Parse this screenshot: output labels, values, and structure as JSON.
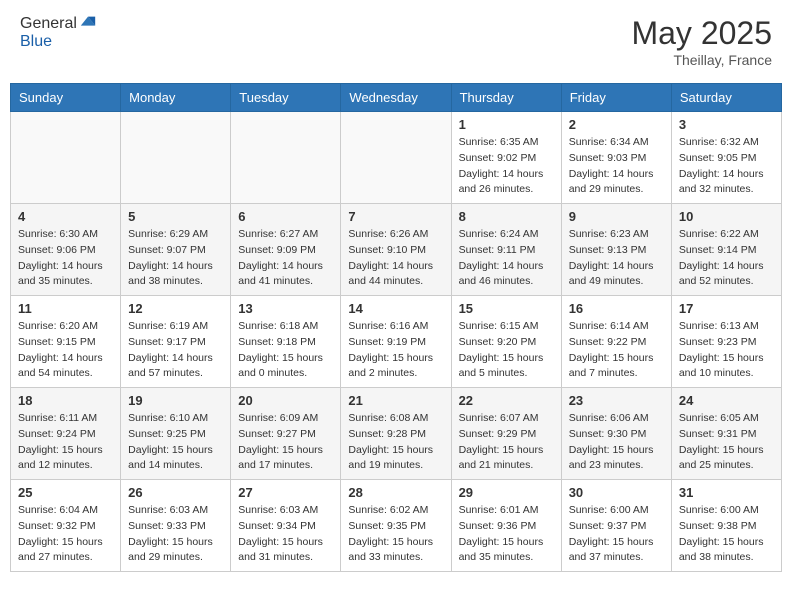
{
  "header": {
    "logo_line1": "General",
    "logo_line2": "Blue",
    "month": "May 2025",
    "location": "Theillay, France"
  },
  "weekdays": [
    "Sunday",
    "Monday",
    "Tuesday",
    "Wednesday",
    "Thursday",
    "Friday",
    "Saturday"
  ],
  "weeks": [
    [
      {
        "day": "",
        "info": ""
      },
      {
        "day": "",
        "info": ""
      },
      {
        "day": "",
        "info": ""
      },
      {
        "day": "",
        "info": ""
      },
      {
        "day": "1",
        "info": "Sunrise: 6:35 AM\nSunset: 9:02 PM\nDaylight: 14 hours\nand 26 minutes."
      },
      {
        "day": "2",
        "info": "Sunrise: 6:34 AM\nSunset: 9:03 PM\nDaylight: 14 hours\nand 29 minutes."
      },
      {
        "day": "3",
        "info": "Sunrise: 6:32 AM\nSunset: 9:05 PM\nDaylight: 14 hours\nand 32 minutes."
      }
    ],
    [
      {
        "day": "4",
        "info": "Sunrise: 6:30 AM\nSunset: 9:06 PM\nDaylight: 14 hours\nand 35 minutes."
      },
      {
        "day": "5",
        "info": "Sunrise: 6:29 AM\nSunset: 9:07 PM\nDaylight: 14 hours\nand 38 minutes."
      },
      {
        "day": "6",
        "info": "Sunrise: 6:27 AM\nSunset: 9:09 PM\nDaylight: 14 hours\nand 41 minutes."
      },
      {
        "day": "7",
        "info": "Sunrise: 6:26 AM\nSunset: 9:10 PM\nDaylight: 14 hours\nand 44 minutes."
      },
      {
        "day": "8",
        "info": "Sunrise: 6:24 AM\nSunset: 9:11 PM\nDaylight: 14 hours\nand 46 minutes."
      },
      {
        "day": "9",
        "info": "Sunrise: 6:23 AM\nSunset: 9:13 PM\nDaylight: 14 hours\nand 49 minutes."
      },
      {
        "day": "10",
        "info": "Sunrise: 6:22 AM\nSunset: 9:14 PM\nDaylight: 14 hours\nand 52 minutes."
      }
    ],
    [
      {
        "day": "11",
        "info": "Sunrise: 6:20 AM\nSunset: 9:15 PM\nDaylight: 14 hours\nand 54 minutes."
      },
      {
        "day": "12",
        "info": "Sunrise: 6:19 AM\nSunset: 9:17 PM\nDaylight: 14 hours\nand 57 minutes."
      },
      {
        "day": "13",
        "info": "Sunrise: 6:18 AM\nSunset: 9:18 PM\nDaylight: 15 hours\nand 0 minutes."
      },
      {
        "day": "14",
        "info": "Sunrise: 6:16 AM\nSunset: 9:19 PM\nDaylight: 15 hours\nand 2 minutes."
      },
      {
        "day": "15",
        "info": "Sunrise: 6:15 AM\nSunset: 9:20 PM\nDaylight: 15 hours\nand 5 minutes."
      },
      {
        "day": "16",
        "info": "Sunrise: 6:14 AM\nSunset: 9:22 PM\nDaylight: 15 hours\nand 7 minutes."
      },
      {
        "day": "17",
        "info": "Sunrise: 6:13 AM\nSunset: 9:23 PM\nDaylight: 15 hours\nand 10 minutes."
      }
    ],
    [
      {
        "day": "18",
        "info": "Sunrise: 6:11 AM\nSunset: 9:24 PM\nDaylight: 15 hours\nand 12 minutes."
      },
      {
        "day": "19",
        "info": "Sunrise: 6:10 AM\nSunset: 9:25 PM\nDaylight: 15 hours\nand 14 minutes."
      },
      {
        "day": "20",
        "info": "Sunrise: 6:09 AM\nSunset: 9:27 PM\nDaylight: 15 hours\nand 17 minutes."
      },
      {
        "day": "21",
        "info": "Sunrise: 6:08 AM\nSunset: 9:28 PM\nDaylight: 15 hours\nand 19 minutes."
      },
      {
        "day": "22",
        "info": "Sunrise: 6:07 AM\nSunset: 9:29 PM\nDaylight: 15 hours\nand 21 minutes."
      },
      {
        "day": "23",
        "info": "Sunrise: 6:06 AM\nSunset: 9:30 PM\nDaylight: 15 hours\nand 23 minutes."
      },
      {
        "day": "24",
        "info": "Sunrise: 6:05 AM\nSunset: 9:31 PM\nDaylight: 15 hours\nand 25 minutes."
      }
    ],
    [
      {
        "day": "25",
        "info": "Sunrise: 6:04 AM\nSunset: 9:32 PM\nDaylight: 15 hours\nand 27 minutes."
      },
      {
        "day": "26",
        "info": "Sunrise: 6:03 AM\nSunset: 9:33 PM\nDaylight: 15 hours\nand 29 minutes."
      },
      {
        "day": "27",
        "info": "Sunrise: 6:03 AM\nSunset: 9:34 PM\nDaylight: 15 hours\nand 31 minutes."
      },
      {
        "day": "28",
        "info": "Sunrise: 6:02 AM\nSunset: 9:35 PM\nDaylight: 15 hours\nand 33 minutes."
      },
      {
        "day": "29",
        "info": "Sunrise: 6:01 AM\nSunset: 9:36 PM\nDaylight: 15 hours\nand 35 minutes."
      },
      {
        "day": "30",
        "info": "Sunrise: 6:00 AM\nSunset: 9:37 PM\nDaylight: 15 hours\nand 37 minutes."
      },
      {
        "day": "31",
        "info": "Sunrise: 6:00 AM\nSunset: 9:38 PM\nDaylight: 15 hours\nand 38 minutes."
      }
    ]
  ]
}
